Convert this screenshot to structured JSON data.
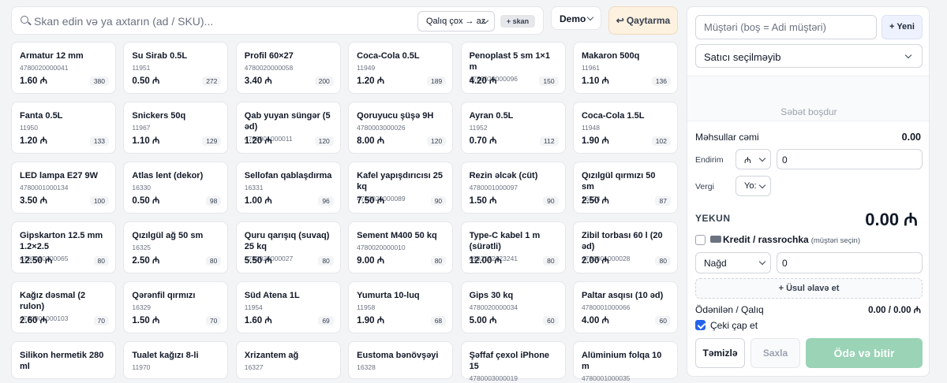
{
  "search": {
    "placeholder": "Skan edin və ya axtarın (ad / SKU)..."
  },
  "sort": {
    "selected": "Qalıq çox → az"
  },
  "scan": {
    "label": "skan",
    "icon": "plus-icon"
  },
  "demo": {
    "label": "Demo"
  },
  "return_btn": {
    "label": "Qaytarma",
    "icon": "return-arrow-icon"
  },
  "currency_symbol": "₼",
  "products": [
    {
      "name": "Armatur 12 mm",
      "sku": "4780020000041",
      "price": "1.60 ₼",
      "stock": "380"
    },
    {
      "name": "Su Sirab 0.5L",
      "sku": "11951",
      "price": "0.50 ₼",
      "stock": "272"
    },
    {
      "name": "Profil 60×27",
      "sku": "4780020000058",
      "price": "3.40 ₼",
      "stock": "200"
    },
    {
      "name": "Coca-Cola 0.5L",
      "sku": "11949",
      "price": "1.20 ₼",
      "stock": "189"
    },
    {
      "name": "Penoplast 5 sm 1×1 m",
      "sku": "4780020000096",
      "price": "4.20 ₼",
      "stock": "150"
    },
    {
      "name": "Makaron 500q",
      "sku": "11961",
      "price": "1.10 ₼",
      "stock": "136"
    },
    {
      "name": "Fanta 0.5L",
      "sku": "11950",
      "price": "1.20 ₼",
      "stock": "133"
    },
    {
      "name": "Snickers 50q",
      "sku": "11967",
      "price": "1.10 ₼",
      "stock": "129"
    },
    {
      "name": "Qab yuyan süngər (5 əd)",
      "sku": "4780001000011",
      "price": "1.20 ₼",
      "stock": "120"
    },
    {
      "name": "Qoruyucu şüşə 9H",
      "sku": "4780003000026",
      "price": "8.00 ₼",
      "stock": "120"
    },
    {
      "name": "Ayran 0.5L",
      "sku": "11952",
      "price": "0.70 ₼",
      "stock": "112"
    },
    {
      "name": "Coca-Cola 1.5L",
      "sku": "11948",
      "price": "1.90 ₼",
      "stock": "102"
    },
    {
      "name": "LED lampa E27 9W",
      "sku": "4780001000134",
      "price": "3.50 ₼",
      "stock": "100"
    },
    {
      "name": "Atlas lent (dekor)",
      "sku": "16330",
      "price": "0.50 ₼",
      "stock": "98"
    },
    {
      "name": "Sellofan qablaşdırma",
      "sku": "16331",
      "price": "1.00 ₼",
      "stock": "96"
    },
    {
      "name": "Kafel yapışdırıcısı 25 kq",
      "sku": "4780020000089",
      "price": "7.50 ₼",
      "stock": "90"
    },
    {
      "name": "Rezin əlcək (cüt)",
      "sku": "4780001000097",
      "price": "1.50 ₼",
      "stock": "90"
    },
    {
      "name": "Qızılgül qırmızı 50 sm",
      "sku": "16324",
      "price": "2.50 ₼",
      "stock": "87"
    },
    {
      "name": "Gipskarton 12.5 mm 1.2×2.5",
      "sku": "4780020000065",
      "price": "12.50 ₼",
      "stock": "80"
    },
    {
      "name": "Qızılgül ağ 50 sm",
      "sku": "16325",
      "price": "2.50 ₼",
      "stock": "80"
    },
    {
      "name": "Quru qarışıq (suvaq) 25 kq",
      "sku": "4780020000027",
      "price": "5.50 ₼",
      "stock": "80"
    },
    {
      "name": "Sement M400 50 kq",
      "sku": "4780020000010",
      "price": "9.00 ₼",
      "stock": "80"
    },
    {
      "name": "Type-C kabel 1 m (sürətli)",
      "sku": "6932172623241",
      "price": "12.00 ₼",
      "stock": "80"
    },
    {
      "name": "Zibil torbası 60 l (20 əd)",
      "sku": "4780001000028",
      "price": "2.00 ₼",
      "stock": "80"
    },
    {
      "name": "Kağız dəsmal (2 rulon)",
      "sku": "4780001000103",
      "price": "2.60 ₼",
      "stock": "70"
    },
    {
      "name": "Qərənfil qırmızı",
      "sku": "16329",
      "price": "1.50 ₼",
      "stock": "70"
    },
    {
      "name": "Süd Atena 1L",
      "sku": "11954",
      "price": "1.60 ₼",
      "stock": "69"
    },
    {
      "name": "Yumurta 10-luq",
      "sku": "11958",
      "price": "1.90 ₼",
      "stock": "68"
    },
    {
      "name": "Gips 30 kq",
      "sku": "4780020000034",
      "price": "5.00 ₼",
      "stock": "60"
    },
    {
      "name": "Paltar asqısı (10 əd)",
      "sku": "4780001000066",
      "price": "4.00 ₼",
      "stock": "60"
    },
    {
      "name": "Silikon hermetik 280 ml",
      "sku": "",
      "price": "",
      "stock": ""
    },
    {
      "name": "Tualet kağızı 8-li",
      "sku": "11970",
      "price": "",
      "stock": ""
    },
    {
      "name": "Xrizantem ağ",
      "sku": "16327",
      "price": "",
      "stock": ""
    },
    {
      "name": "Eustoma bənövşəyi",
      "sku": "16328",
      "price": "",
      "stock": ""
    },
    {
      "name": "Şəffaf çexol iPhone 15",
      "sku": "4780003000019",
      "price": "",
      "stock": ""
    },
    {
      "name": "Alüminium folqa 10 m",
      "sku": "4780001000035",
      "price": "",
      "stock": ""
    }
  ],
  "panel": {
    "customer_placeholder": "Müştəri (boş = Adi müştəri)",
    "new_label": "+ Yeni",
    "seller": "Satıcı seçilməyib",
    "cart_empty": "Səbət boşdur",
    "products_sum_label": "Məhsullar cəmi",
    "products_sum_value": "0.00",
    "discount_label": "Endirim",
    "discount_type": "₼",
    "discount_value": "0",
    "tax_label": "Vergi",
    "tax_value": "Yo:",
    "total_label": "YEKUN",
    "total_value": "0.00 ₼",
    "credit_label": "Kredit / rassrochka",
    "credit_hint": "(müştəri seçin)",
    "payment_method": "Nağd",
    "payment_amount": "0",
    "add_method": "+ Üsul əlavə et",
    "paid_label": "Ödənilən / Qalıq",
    "paid_value": "0.00 / 0.00 ₼",
    "print_receipt": "Çeki çap et",
    "print_checked": true,
    "clear_btn": "Təmizlə",
    "save_btn": "Saxla",
    "pay_btn": "Ödə və bitir"
  },
  "colors": {
    "accent": "#2563eb",
    "pay": "#9ad3b5",
    "return_bg": "#fdf1df"
  }
}
